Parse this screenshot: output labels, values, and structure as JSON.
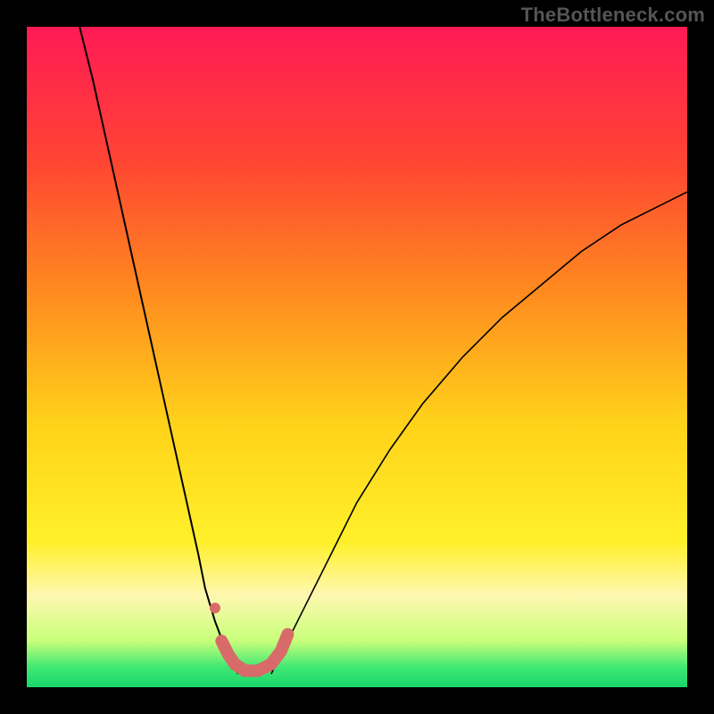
{
  "watermark": "TheBottleneck.com",
  "chart_data": {
    "type": "line",
    "title": "",
    "xlabel": "",
    "ylabel": "",
    "xlim": [
      0,
      100
    ],
    "ylim": [
      0,
      100
    ],
    "gradient_stops": [
      {
        "offset": 0,
        "color": "#ff1a55"
      },
      {
        "offset": 20,
        "color": "#ff4433"
      },
      {
        "offset": 40,
        "color": "#ff8a1f"
      },
      {
        "offset": 60,
        "color": "#ffd21a"
      },
      {
        "offset": 78,
        "color": "#fff02a"
      },
      {
        "offset": 86,
        "color": "#fff7b0"
      },
      {
        "offset": 93,
        "color": "#c8ff7a"
      },
      {
        "offset": 97,
        "color": "#3fe873"
      },
      {
        "offset": 100,
        "color": "#18d66a"
      }
    ],
    "series": [
      {
        "name": "curve-left",
        "x": [
          8,
          10,
          12,
          14,
          16,
          18,
          20,
          22,
          24,
          26,
          27,
          28.5,
          30,
          31,
          32
        ],
        "y": [
          100,
          92,
          83,
          74,
          65,
          56,
          47,
          38,
          29,
          20,
          15,
          10,
          6,
          4,
          2
        ],
        "stroke": "#000",
        "width": 2
      },
      {
        "name": "curve-right",
        "x": [
          37,
          39,
          42,
          46,
          50,
          55,
          60,
          66,
          72,
          78,
          84,
          90,
          96,
          100
        ],
        "y": [
          2,
          6,
          12,
          20,
          28,
          36,
          43,
          50,
          56,
          61,
          66,
          70,
          73,
          75
        ],
        "stroke": "#000",
        "width": 1.6
      },
      {
        "name": "red-underline",
        "x": [
          29.5,
          30.5,
          31.5,
          33,
          35,
          37,
          38.5,
          39.5
        ],
        "y": [
          7,
          5,
          3.5,
          2.5,
          2.5,
          3.5,
          5.5,
          8
        ],
        "stroke": "#d86a6a",
        "width": 14,
        "linecap": "round"
      }
    ],
    "markers": [
      {
        "name": "red-dot",
        "x": 28.5,
        "y": 12,
        "r": 6,
        "fill": "#d86a6a"
      }
    ]
  }
}
